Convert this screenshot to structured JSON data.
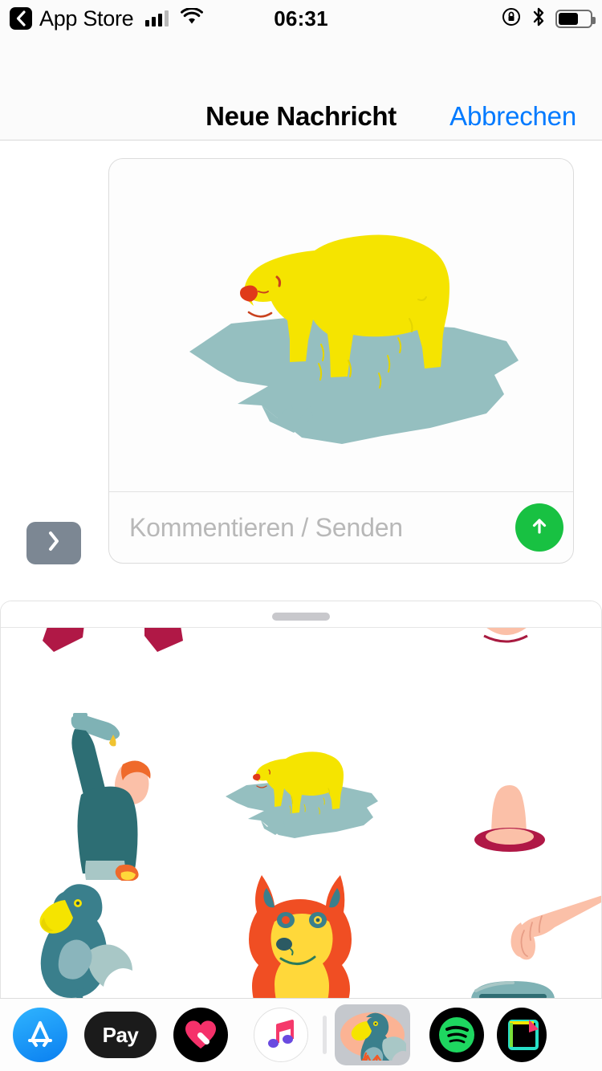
{
  "status_bar": {
    "back_app": "App Store",
    "back_icon": "chevron-left-icon",
    "signal_icon": "cellular-signal-icon",
    "wifi_icon": "wifi-icon",
    "time": "06:31",
    "rotation_lock_icon": "rotation-lock-icon",
    "bluetooth_icon": "bluetooth-icon",
    "battery_icon": "battery-icon",
    "battery_level_percent": 62
  },
  "nav_bar": {
    "title": "Neue Nachricht",
    "cancel_label": "Abbrechen"
  },
  "compose": {
    "expand_button_icon": "chevron-right-icon",
    "input_placeholder": "Kommentieren / Senden",
    "input_value": "",
    "send_button_icon": "arrow-up-icon",
    "send_button_color": "#18c142",
    "preview_sticker_name": "polar-bear-on-ice-sticker"
  },
  "sticker_drawer": {
    "grabber_icon": "drag-handle-icon",
    "stickers": [
      {
        "name": "red-shape-top-left-partial",
        "label": "partial sticker"
      },
      {
        "name": "red-shape-top-mid-partial",
        "label": "partial sticker"
      },
      {
        "name": "peach-curve-top-right-partial",
        "label": "partial sticker"
      },
      {
        "name": "person-pouring-bottle-sticker",
        "label": "person pouring bottle"
      },
      {
        "name": "polar-bear-on-ice-sticker",
        "label": "polar bear on ice floe"
      },
      {
        "name": "condom-sticker",
        "label": "condom"
      },
      {
        "name": "dodo-bird-sticker",
        "label": "dodo bird"
      },
      {
        "name": "shiba-dog-sticker",
        "label": "shiba dog"
      },
      {
        "name": "pointing-hand-sticker",
        "label": "pointing hand"
      },
      {
        "name": "toaster-sticker-partial",
        "label": "toaster"
      }
    ]
  },
  "app_drawer": {
    "apps": [
      {
        "name": "app-store-app",
        "icon": "app-store-icon",
        "selected": false
      },
      {
        "name": "apple-pay-app",
        "icon": "apple-pay-icon",
        "label": "Pay",
        "selected": false
      },
      {
        "name": "digital-touch-app",
        "icon": "heart-icon",
        "selected": false
      },
      {
        "name": "music-app",
        "icon": "music-note-icon",
        "selected": false
      },
      {
        "name": "dodo-sticker-pack-app",
        "icon": "dodo-icon",
        "selected": true
      },
      {
        "name": "spotify-app",
        "icon": "spotify-icon",
        "selected": false
      },
      {
        "name": "clips-app",
        "icon": "clips-icon",
        "selected": false
      }
    ]
  },
  "colors": {
    "accent_blue": "#007aff",
    "send_green": "#18c142",
    "bear_yellow": "#f5e400",
    "ice_teal": "#95bfc0",
    "dodo_teal": "#3a7f8c",
    "dog_orange": "#f04e23",
    "dog_yellow": "#ffd83a",
    "skin_peach": "#fbc0a8",
    "deep_red": "#b01846"
  }
}
